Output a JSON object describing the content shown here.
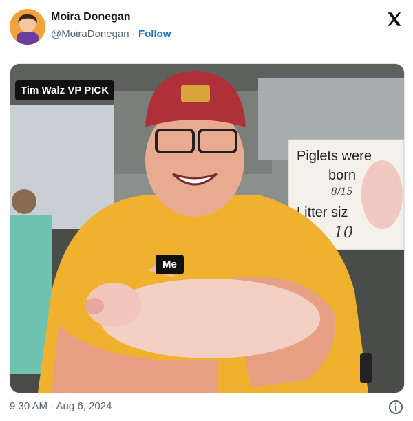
{
  "tweet": {
    "author_name": "Moira Donegan",
    "handle": "@MoiraDonegan",
    "separator": "·",
    "follow_label": "Follow",
    "timestamp": "9:30 AM · Aug 6, 2024"
  },
  "media": {
    "caption_top": "Tim Walz VP PICK",
    "caption_bottom": "Me",
    "sign_title": "Piglets were",
    "sign_born": "born",
    "sign_date": "8/15",
    "sign_litter": "Litter siz",
    "sign_litter_value": "10"
  },
  "icons": {
    "brand": "x-logo-icon",
    "info": "info-icon",
    "avatar": "avatar-image"
  },
  "colors": {
    "follow": "#1d73c9",
    "caption_bg": "#111111",
    "shirt": "#f0b12f",
    "cap": "#b0303a"
  }
}
